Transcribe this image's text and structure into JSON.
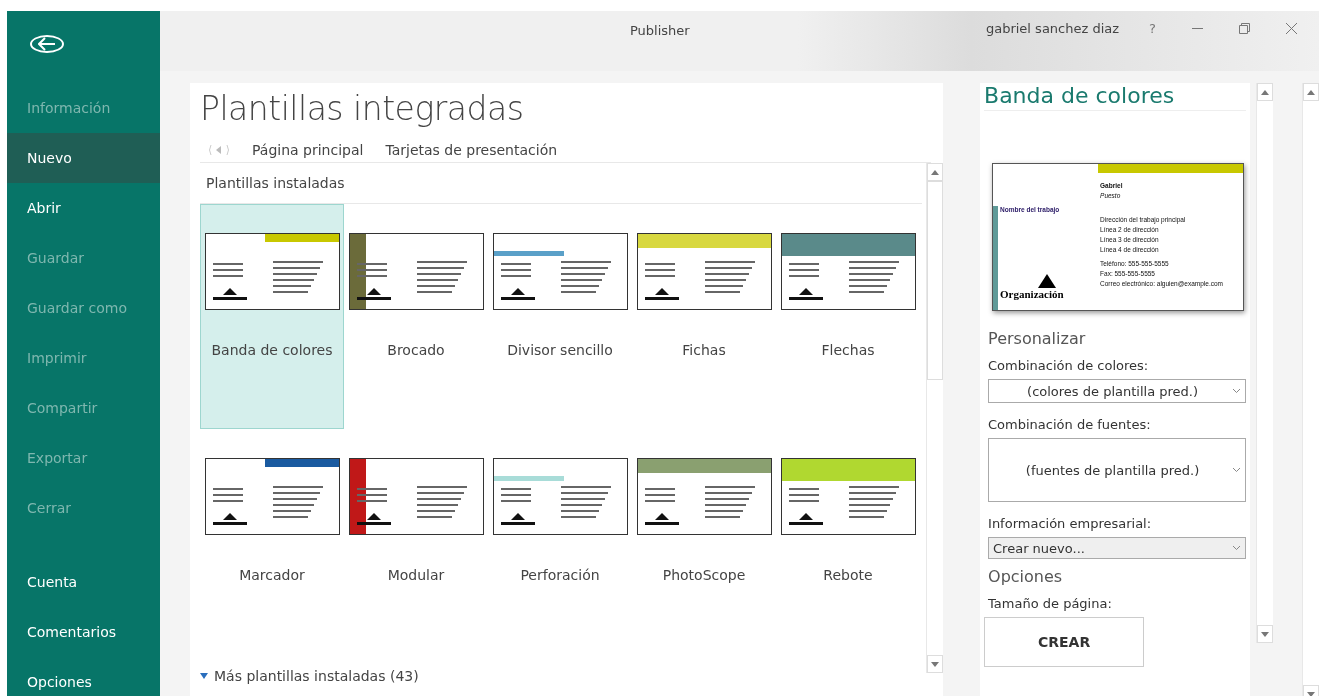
{
  "window": {
    "title": "Publisher",
    "user": "gabriel sanchez diaz",
    "help": "?"
  },
  "sidebar": {
    "items": [
      {
        "label": "Información",
        "selected": false,
        "disabled": true
      },
      {
        "label": "Nuevo",
        "selected": true,
        "disabled": false
      },
      {
        "label": "Abrir",
        "selected": false,
        "disabled": false
      },
      {
        "label": "Guardar",
        "selected": false,
        "disabled": true
      },
      {
        "label": "Guardar como",
        "selected": false,
        "disabled": true
      },
      {
        "label": "Imprimir",
        "selected": false,
        "disabled": true
      },
      {
        "label": "Compartir",
        "selected": false,
        "disabled": true
      },
      {
        "label": "Exportar",
        "selected": false,
        "disabled": true
      },
      {
        "label": "Cerrar",
        "selected": false,
        "disabled": true
      }
    ],
    "bottom_items": [
      {
        "label": "Cuenta",
        "selected": false,
        "disabled": false
      },
      {
        "label": "Comentarios",
        "selected": false,
        "disabled": false
      },
      {
        "label": "Opciones",
        "selected": false,
        "disabled": false
      }
    ]
  },
  "page": {
    "title": "Plantillas integradas",
    "breadcrumb": [
      "Página principal",
      "Tarjetas de presentación"
    ],
    "section": "Plantillas instaladas",
    "templates": [
      {
        "name": "Banda de colores",
        "selected": true,
        "color": "#c8c800"
      },
      {
        "name": "Brocado",
        "selected": false,
        "color": "#6b6b3a"
      },
      {
        "name": "Divisor sencillo",
        "selected": false,
        "color": "#5aa0c8"
      },
      {
        "name": "Fichas",
        "selected": false,
        "color": "#d8d840"
      },
      {
        "name": "Flechas",
        "selected": false,
        "color": "#5a8a8a"
      },
      {
        "name": "Marcador",
        "selected": false,
        "color": "#1a5aa0"
      },
      {
        "name": "Modular",
        "selected": false,
        "color": "#c01818"
      },
      {
        "name": "Perforación",
        "selected": false,
        "color": "#a8dcd8"
      },
      {
        "name": "PhotoScope",
        "selected": false,
        "color": "#8aa070"
      },
      {
        "name": "Rebote",
        "selected": false,
        "color": "#b0d830"
      }
    ],
    "more": "Más plantillas instaladas (43)"
  },
  "details": {
    "title": "Banda de colores",
    "preview": {
      "name": "Gabriel",
      "position": "Puesto",
      "job": "Nombre del trabajo",
      "address": [
        "Dirección del trabajo principal",
        "Línea 2 de dirección",
        "Línea 3 de dirección",
        "Línea 4 de dirección"
      ],
      "contact": [
        "Teléfono: 555-555-5555",
        "Fax: 555-555-5555",
        "Correo electrónico: alguien@example.com"
      ],
      "organization": "Organización"
    },
    "customize_heading": "Personalizar",
    "color_scheme": {
      "label": "Combinación de colores:",
      "value": "(colores de plantilla pred.)"
    },
    "font_scheme": {
      "label": "Combinación de fuentes:",
      "value": "(fuentes de plantilla pred.)"
    },
    "business_info": {
      "label": "Información empresarial:",
      "value": "Crear nuevo..."
    },
    "options_heading": "Opciones",
    "page_size_label": "Tamaño de página:",
    "create_button": "CREAR"
  }
}
